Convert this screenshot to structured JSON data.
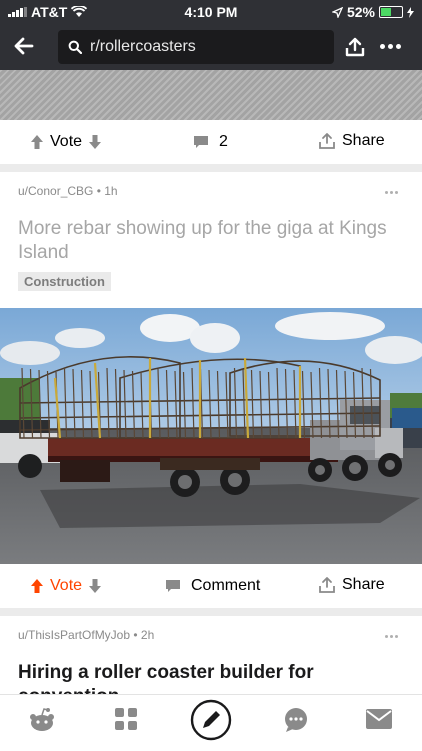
{
  "status": {
    "carrier": "AT&T",
    "time": "4:10 PM",
    "battery": "52%",
    "battery_level": 0.52
  },
  "search": {
    "query": "r/rollercoasters"
  },
  "post1_actions": {
    "vote": "Vote",
    "comments": "2",
    "share": "Share"
  },
  "post2": {
    "meta": "u/Conor_CBG • 1h",
    "title": "More rebar showing up for the giga at Kings Island",
    "flair": "Construction",
    "vote": "Vote",
    "comment": "Comment",
    "share": "Share",
    "upvote_color": "#ff4500"
  },
  "post3": {
    "meta": "u/ThisIsPartOfMyJob • 2h",
    "title": "Hiring a roller coaster builder for convention"
  },
  "bottom_nav": [
    "home-icon",
    "communities-icon",
    "create-post-icon",
    "chat-icon",
    "inbox-icon"
  ]
}
